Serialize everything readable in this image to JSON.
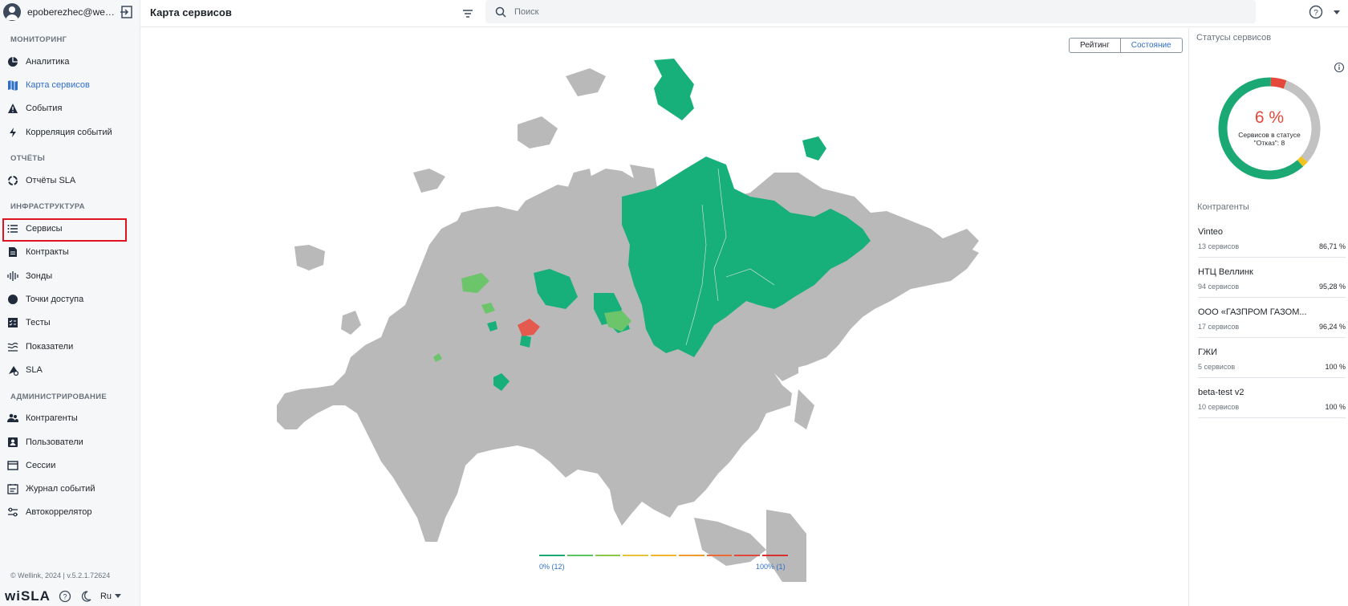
{
  "user": {
    "name": "epoberezhec@well..."
  },
  "nav": {
    "sections": [
      {
        "title": "МОНИТОРИНГ",
        "items": [
          {
            "label": "Аналитика",
            "icon": "pie-chart-icon"
          },
          {
            "label": "Карта сервисов",
            "icon": "map-icon",
            "active": true
          },
          {
            "label": "События",
            "icon": "warning-icon"
          },
          {
            "label": "Корреляция событий",
            "icon": "lightning-icon"
          }
        ]
      },
      {
        "title": "ОТЧЁТЫ",
        "items": [
          {
            "label": "Отчёты SLA",
            "icon": "circle-progress-icon"
          }
        ]
      },
      {
        "title": "ИНФРАСТРУКТУРА",
        "items": [
          {
            "label": "Сервисы",
            "icon": "list-icon",
            "highlighted": true
          },
          {
            "label": "Контракты",
            "icon": "document-icon"
          },
          {
            "label": "Зонды",
            "icon": "probe-icon"
          },
          {
            "label": "Точки доступа",
            "icon": "dot-icon"
          },
          {
            "label": "Тесты",
            "icon": "checklist-icon"
          },
          {
            "label": "Показатели",
            "icon": "waves-icon"
          },
          {
            "label": "SLA",
            "icon": "sla-icon"
          }
        ]
      },
      {
        "title": "АДМИНИСТРИРОВАНИЕ",
        "items": [
          {
            "label": "Контрагенты",
            "icon": "people-icon"
          },
          {
            "label": "Пользователи",
            "icon": "user-badge-icon"
          },
          {
            "label": "Сессии",
            "icon": "window-icon"
          },
          {
            "label": "Журнал событий",
            "icon": "log-icon"
          },
          {
            "label": "Автокоррелятор",
            "icon": "sliders-icon"
          }
        ]
      }
    ]
  },
  "footer": {
    "copyright": "© Wellink, 2024 | v.5.2.1.72624",
    "logo": "wiSLA",
    "language": "Ru"
  },
  "header": {
    "title": "Карта сервисов",
    "search_placeholder": "Поиск"
  },
  "map": {
    "toggle": {
      "rating": "Рейтинг",
      "state": "Состояние",
      "selected": "Состояние"
    },
    "legend": {
      "left": "0% (12)",
      "right": "100% (1)",
      "colors": [
        "#1aa874",
        "#5bc45c",
        "#8dc74a",
        "#e8c23a",
        "#f2b431",
        "#f0992e",
        "#ea6a32",
        "#e2483a",
        "#d8302f"
      ]
    },
    "region_colors": {
      "ok": "#17b07a",
      "partial": "#6cc56a",
      "fail": "#e55a4e",
      "none": "#b9b9b9"
    }
  },
  "status_panel": {
    "title": "Статусы сервисов",
    "percent": "6 %",
    "caption": "Сервисов в статусе \"Отказ\": 8",
    "donut": {
      "ok": 0.62,
      "fail": 0.05,
      "warn": 0.02,
      "other": 0.31,
      "colors": {
        "ok": "#1aa874",
        "fail": "#e5483a",
        "warn": "#f2c21f",
        "other": "#c2c2c2"
      }
    }
  },
  "counterparties": {
    "title": "Контрагенты",
    "items": [
      {
        "name": "Vinteo",
        "count": "13 сервисов",
        "value": "86,71 %"
      },
      {
        "name": "НТЦ Веллинк",
        "count": "94 сервисов",
        "value": "95,28 %"
      },
      {
        "name": "ООО «ГАЗПРОМ ГАЗОМ...",
        "count": "17 сервисов",
        "value": "96,24 %"
      },
      {
        "name": "ГЖИ",
        "count": "5 сервисов",
        "value": "100 %"
      },
      {
        "name": "beta-test v2",
        "count": "10 сервисов",
        "value": "100 %"
      }
    ]
  }
}
